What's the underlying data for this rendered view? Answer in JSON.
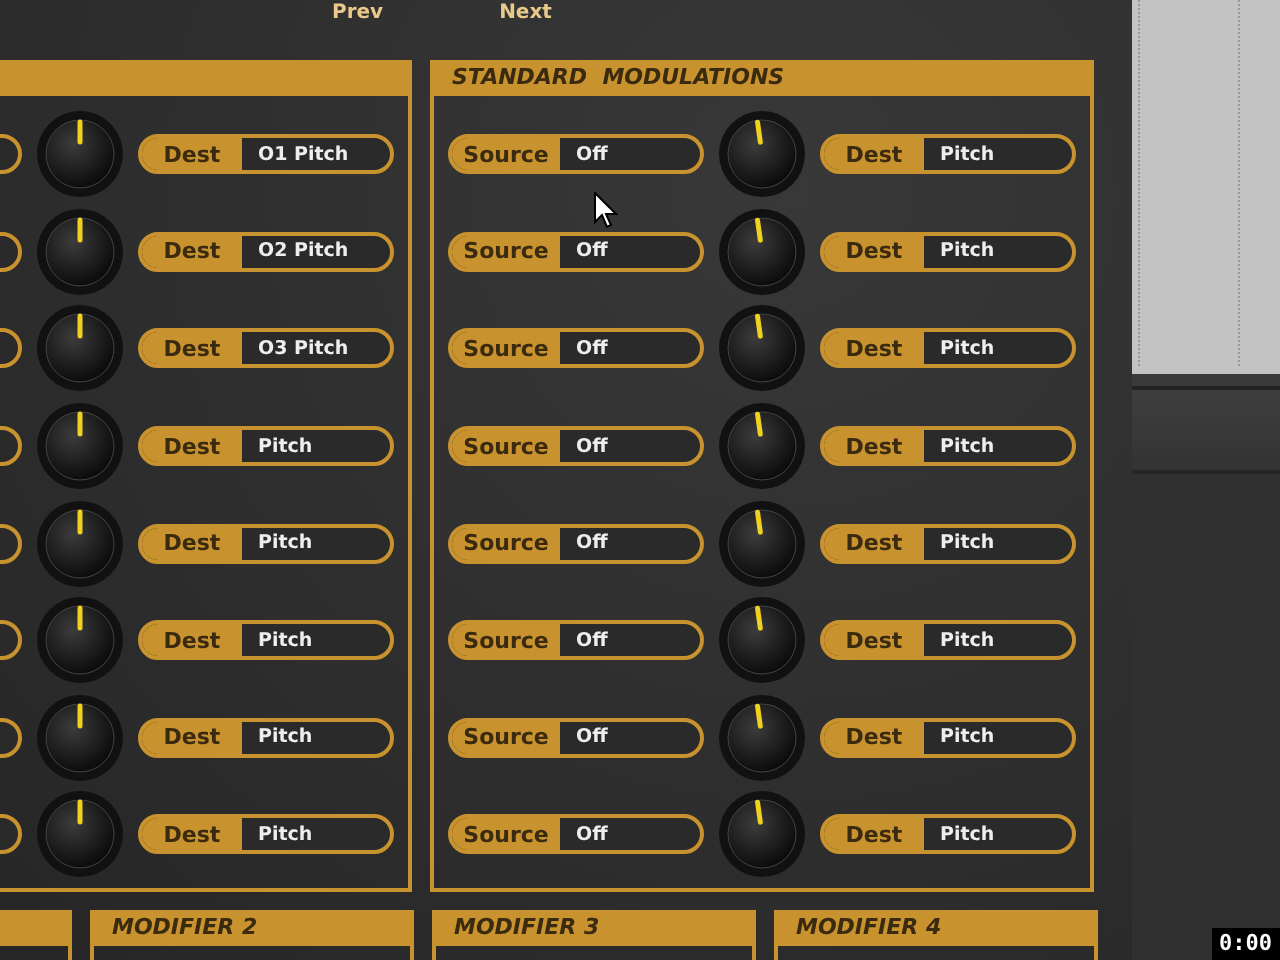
{
  "nav": [
    "Prev",
    "Next"
  ],
  "panels": [
    {
      "rows": [
        {
          "dest_label": "Dest",
          "dest": "O1 Pitch"
        },
        {
          "dest_label": "Dest",
          "dest": "O2 Pitch"
        },
        {
          "dest_label": "Dest",
          "dest": "O3 Pitch"
        },
        {
          "dest_label": "Dest",
          "dest": "Pitch"
        },
        {
          "dest_label": "Dest",
          "dest": "Pitch"
        },
        {
          "dest_label": "Dest",
          "dest": "Pitch"
        },
        {
          "dest_label": "Dest",
          "dest": "Pitch"
        },
        {
          "dest_label": "Dest",
          "dest": "Pitch"
        }
      ]
    },
    {
      "title": "STANDARD  MODULATIONS",
      "rows": [
        {
          "source_label": "Source",
          "source": "Off",
          "dest_label": "Dest",
          "dest": "Pitch"
        },
        {
          "source_label": "Source",
          "source": "Off",
          "dest_label": "Dest",
          "dest": "Pitch"
        },
        {
          "source_label": "Source",
          "source": "Off",
          "dest_label": "Dest",
          "dest": "Pitch"
        },
        {
          "source_label": "Source",
          "source": "Off",
          "dest_label": "Dest",
          "dest": "Pitch"
        },
        {
          "source_label": "Source",
          "source": "Off",
          "dest_label": "Dest",
          "dest": "Pitch"
        },
        {
          "source_label": "Source",
          "source": "Off",
          "dest_label": "Dest",
          "dest": "Pitch"
        },
        {
          "source_label": "Source",
          "source": "Off",
          "dest_label": "Dest",
          "dest": "Pitch"
        },
        {
          "source_label": "Source",
          "source": "Off",
          "dest_label": "Dest",
          "dest": "Pitch"
        }
      ]
    }
  ],
  "modifiers": [
    "MODIFIER 2",
    "MODIFIER 3",
    "MODIFIER 4"
  ],
  "timer": "0:00"
}
